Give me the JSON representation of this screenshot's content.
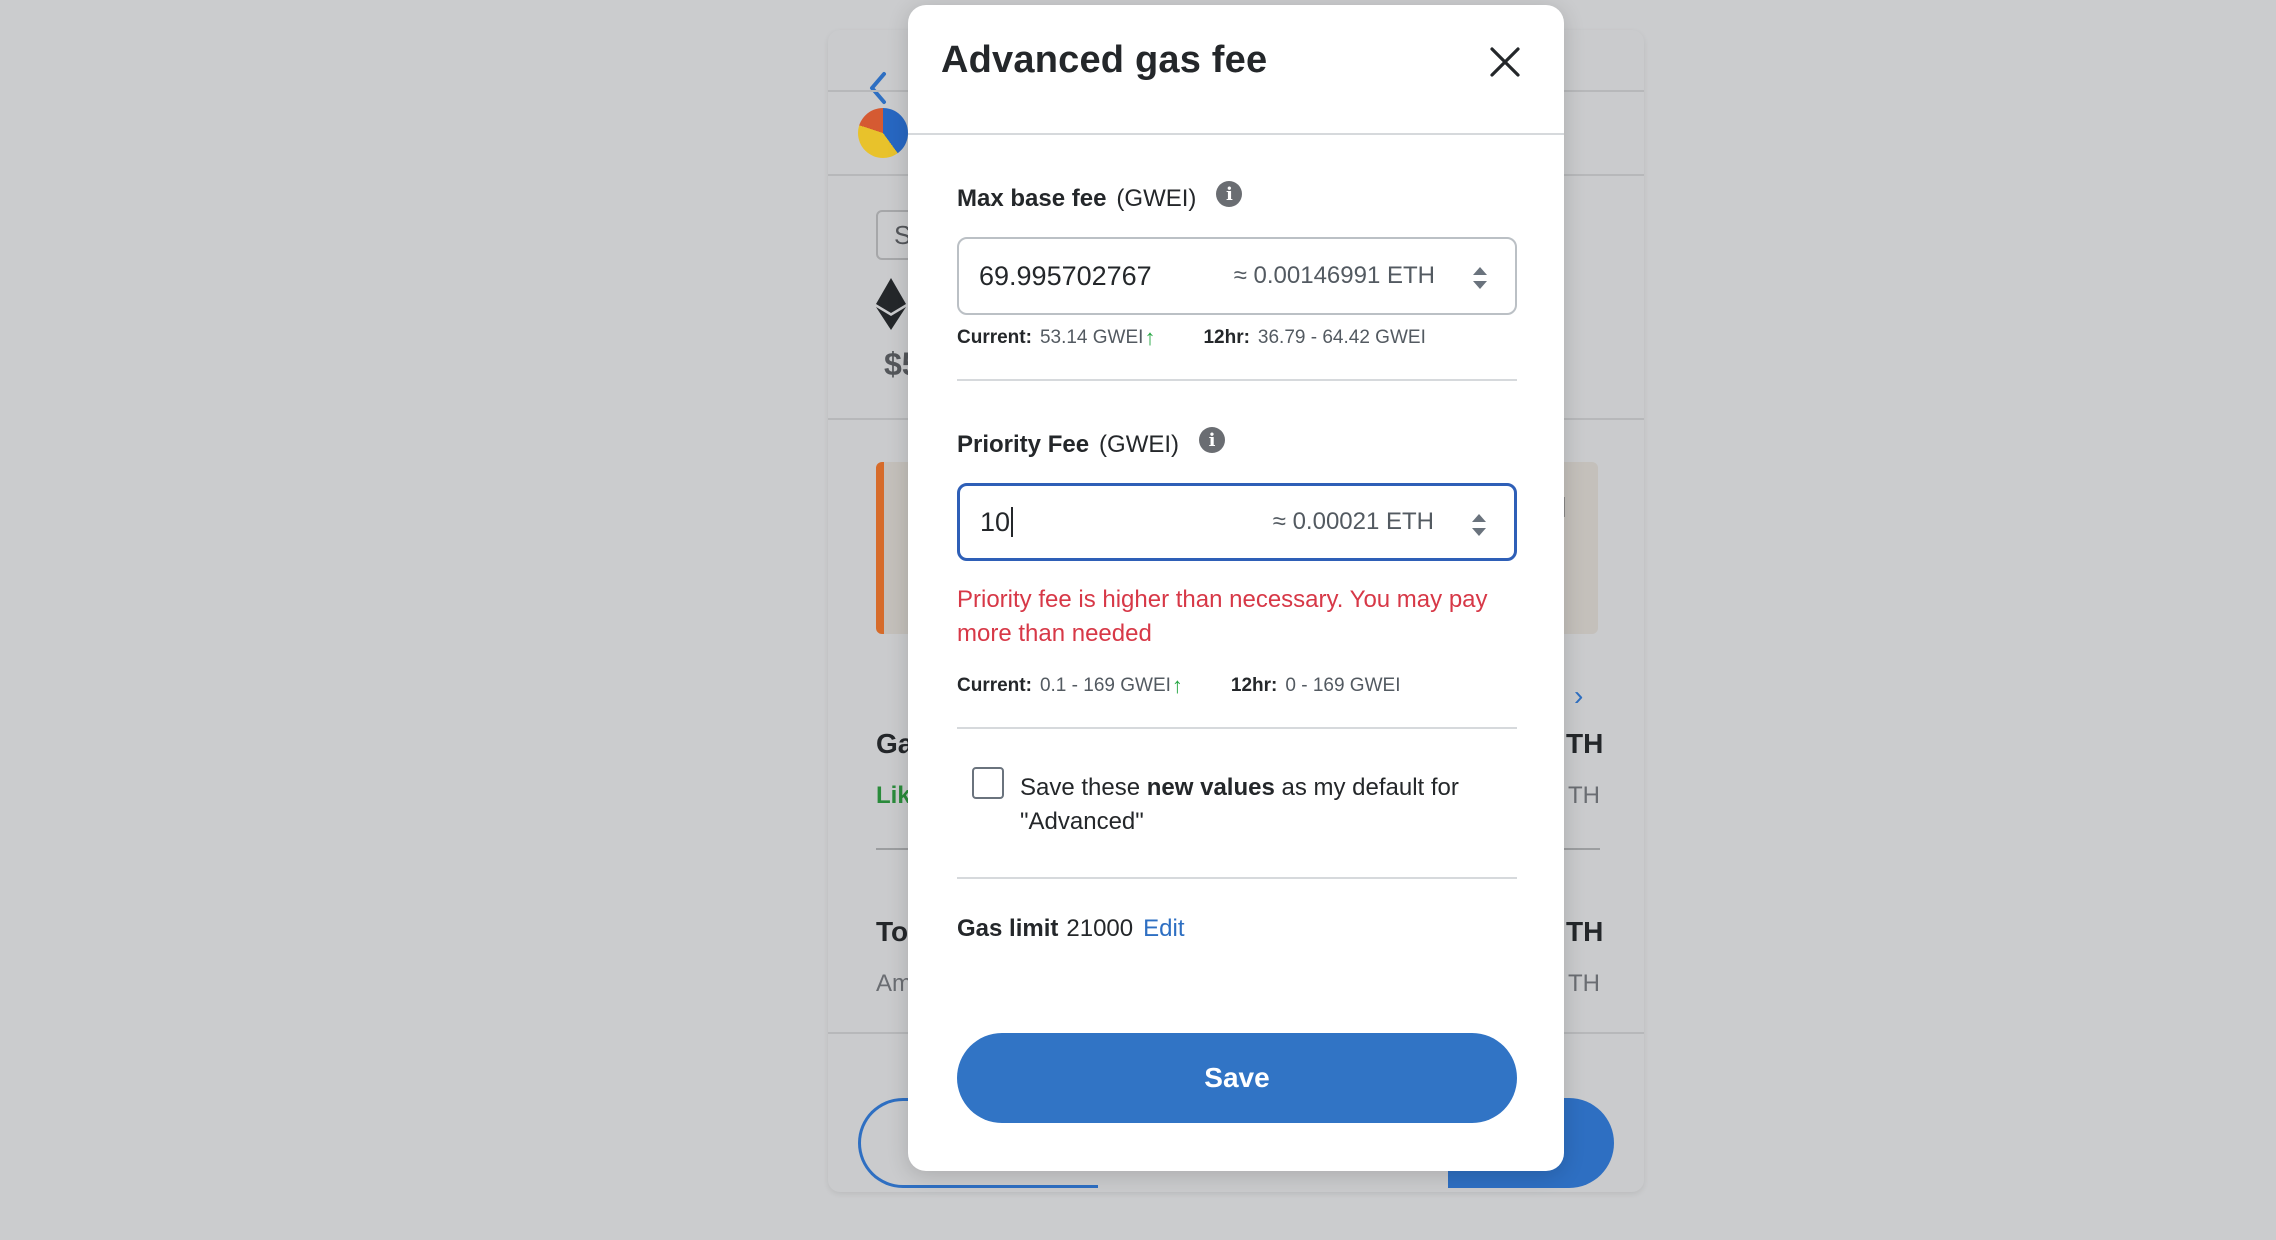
{
  "background": {
    "chip_label": "S",
    "amount_prefix": "$5",
    "gas_label": "Ga",
    "likely_label": "Lik",
    "total_label": "To",
    "amount_label": "Am",
    "col_right_1": "TH",
    "col_right_2": "TH",
    "col_right_3": "TH",
    "col_right_4": "TH",
    "partial_warning": "l"
  },
  "modal": {
    "title": "Advanced gas fee",
    "max_base_fee": {
      "label": "Max base fee",
      "unit": "(GWEI)",
      "value": "69.995702767",
      "approx": "≈ 0.00146991 ETH",
      "current_label": "Current:",
      "current_value": "53.14 GWEI",
      "trend": "↑",
      "history_label": "12hr:",
      "history_value": "36.79 - 64.42 GWEI"
    },
    "priority_fee": {
      "label": "Priority Fee",
      "unit": "(GWEI)",
      "value": "10",
      "approx": "≈ 0.00021 ETH",
      "error": "Priority fee is higher than necessary. You may pay more than needed",
      "current_label": "Current:",
      "current_value": "0.1 - 169 GWEI",
      "trend": "↑",
      "history_label": "12hr:",
      "history_value": "0 - 169 GWEI"
    },
    "save_default": {
      "prefix": "Save these ",
      "bold": "new values",
      "suffix": " as my default for \"Advanced\"",
      "checked": false
    },
    "gas_limit": {
      "label": "Gas limit",
      "value": "21000",
      "edit_label": "Edit"
    },
    "save_button": "Save"
  },
  "colors": {
    "accent": "#3174c5",
    "error": "#d73847",
    "trend_up": "#28a745"
  }
}
